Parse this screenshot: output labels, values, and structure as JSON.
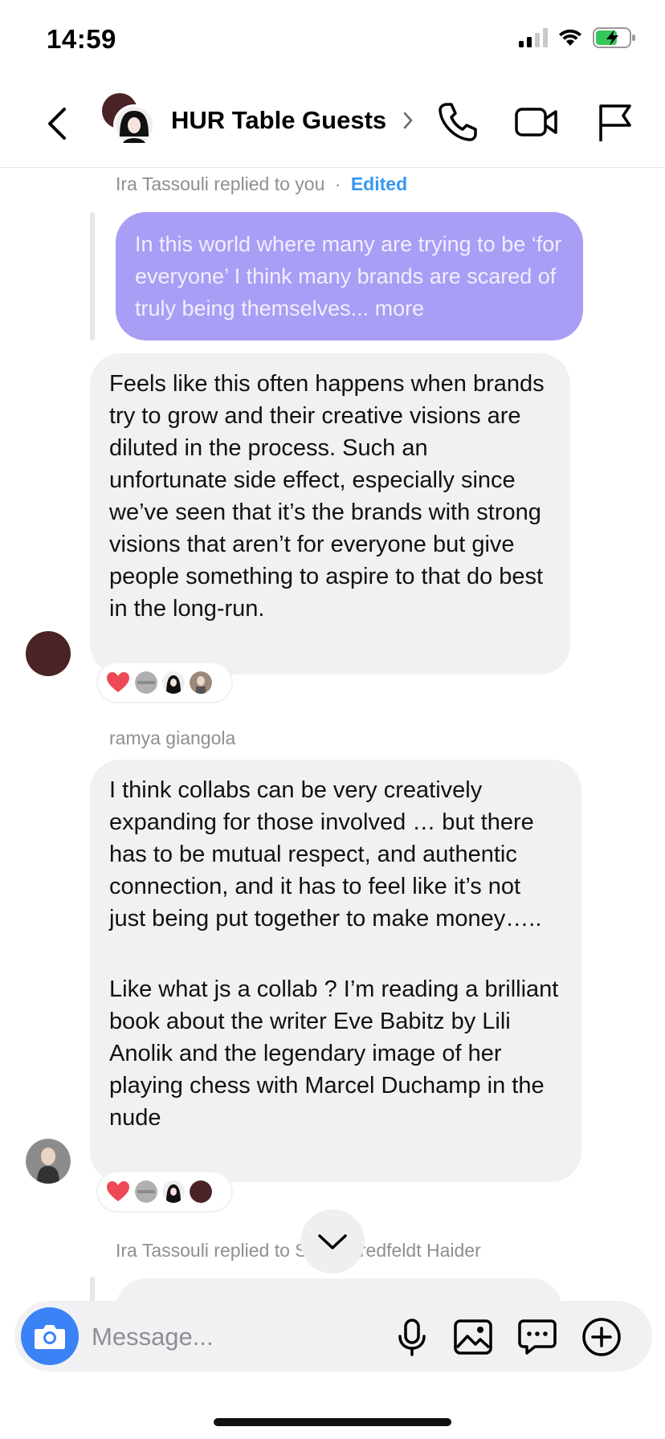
{
  "status_bar": {
    "time": "14:59"
  },
  "header": {
    "title": "HUR Table Guests"
  },
  "messages": {
    "reply_meta": {
      "text": "Ira Tassouli replied to you",
      "separator": "·",
      "edited": "Edited"
    },
    "quoted_message": "In this world where many are trying to be ‘for everyone’ I think many brands are scared of truly being themselves... more",
    "message_1": "Feels like this often happens when brands try to grow and their creative visions are diluted in the process. Such an unfortunate side effect, especially since we’ve seen that it’s the brands with strong visions that aren’t for everyone but give people something to aspire to that do best in the long-run.",
    "sender_2": "ramya giangola",
    "message_2_para_1": "I think collabs can be very creatively expanding for those involved … but there has to be mutual respect, and authentic connection, and it has to feel like it’s not just being put together to make money…..",
    "message_2_para_2": "Like what js a collab ? I’m reading a brilliant book about the writer Eve Babitz by Lili Anolik and the legendary image of her playing chess with Marcel Duchamp in the nude",
    "reply_meta_2": "Ira Tassouli replied to Signe Bredfeldt Haider"
  },
  "composer": {
    "placeholder": "Message..."
  },
  "colors": {
    "accent": "#3897f0",
    "quoted_bubble": "#a89ef5",
    "bubble": "#f1f1f4",
    "camera": "#3b82f6"
  },
  "icons": [
    "back-icon",
    "chevron-right-icon",
    "phone-icon",
    "video-icon",
    "flag-icon",
    "camera-icon",
    "mic-icon",
    "gallery-icon",
    "sticker-icon",
    "plus-icon",
    "chevron-down-icon",
    "heart-icon"
  ]
}
